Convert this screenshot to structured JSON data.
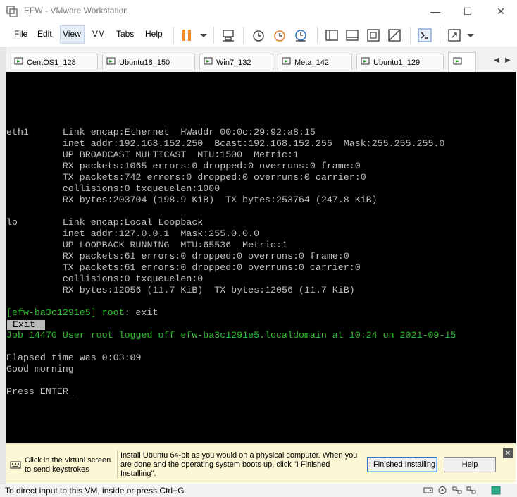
{
  "window": {
    "title": "EFW - VMware Workstation",
    "minimize": "—",
    "maximize": "☐",
    "close": "✕"
  },
  "menu": [
    "File",
    "Edit",
    "View",
    "VM",
    "Tabs",
    "Help"
  ],
  "tabs": [
    "CentOS1_128",
    "Ubuntu18_150",
    "Win7_132",
    "Meta_142",
    "Ubuntu1_129"
  ],
  "tab_scroll": {
    "left": "◀",
    "right": "▶"
  },
  "console": {
    "lines": [
      "eth1      Link encap:Ethernet  HWaddr 00:0c:29:92:a8:15",
      "          inet addr:192.168.152.250  Bcast:192.168.152.255  Mask:255.255.255.0",
      "          UP BROADCAST MULTICAST  MTU:1500  Metric:1",
      "          RX packets:1065 errors:0 dropped:0 overruns:0 frame:0",
      "          TX packets:742 errors:0 dropped:0 overruns:0 carrier:0",
      "          collisions:0 txqueuelen:1000",
      "          RX bytes:203704 (198.9 KiB)  TX bytes:253764 (247.8 KiB)",
      "",
      "lo        Link encap:Local Loopback",
      "          inet addr:127.0.0.1  Mask:255.0.0.0",
      "          UP LOOPBACK RUNNING  MTU:65536  Metric:1",
      "          RX packets:61 errors:0 dropped:0 overruns:0 frame:0",
      "          TX packets:61 errors:0 dropped:0 overruns:0 carrier:0",
      "          collisions:0 txqueuelen:0",
      "          RX bytes:12056 (11.7 KiB)  TX bytes:12056 (11.7 KiB)"
    ],
    "prompt_host": "[efw-ba3c1291e5]",
    "prompt_user": "root",
    "prompt_cmd": ": exit",
    "exit_label": "Exit",
    "job_line": "Job 14470 User root logged off efw-ba3c1291e5.localdomain at 10:24 on 2021-09-15",
    "elapsed": "Elapsed time was 0:03:09",
    "greeting": "Good morning",
    "press_enter": "Press ENTER_"
  },
  "hint": {
    "left_text": "Click in the virtual screen to send keystrokes",
    "main_text": "Install Ubuntu 64-bit as you would on a physical computer. When you are done and the operating system boots up, click \"I Finished Installing\".",
    "finished_button": "I Finished Installing",
    "help_button": "Help",
    "close": "✕"
  },
  "status": {
    "text": "To direct input to this VM, inside or press Ctrl+G."
  },
  "colors": {
    "console_bg": "#000000",
    "console_text": "#bfbfbf",
    "console_green": "#2fc02f",
    "hint_bg": "#fcf7d5",
    "pause_orange": "#f28c28"
  }
}
